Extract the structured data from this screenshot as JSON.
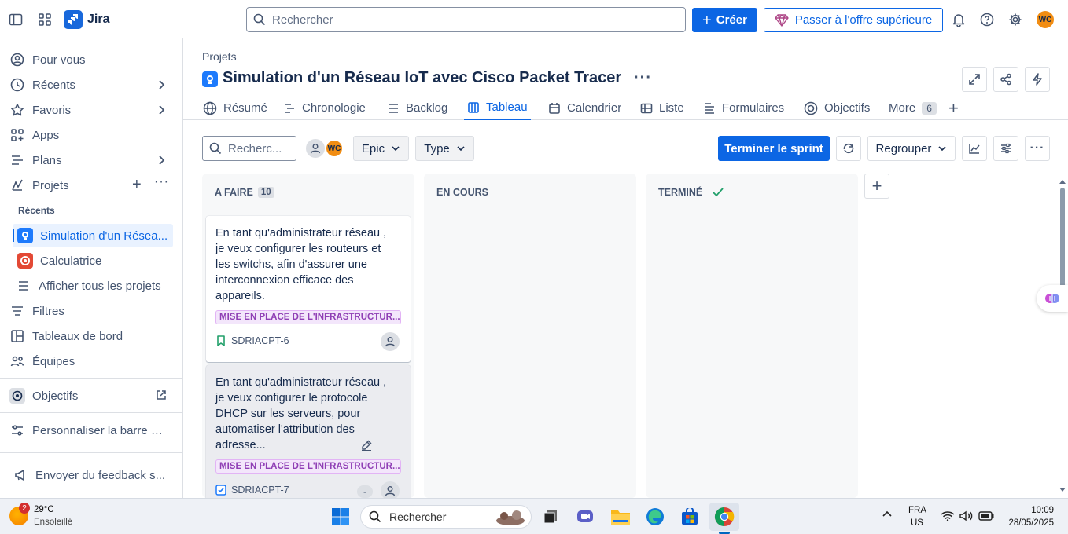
{
  "topbar": {
    "app_name": "Jira",
    "search_placeholder": "Rechercher",
    "create_label": "Créer",
    "upgrade_label": "Passer à l'offre supérieure",
    "user_initials": "WC"
  },
  "sidebar": {
    "items": [
      {
        "label": "Pour vous",
        "icon": "user-circle-icon"
      },
      {
        "label": "Récents",
        "icon": "clock-icon"
      },
      {
        "label": "Favoris",
        "icon": "star-icon"
      },
      {
        "label": "Apps",
        "icon": "apps-icon"
      },
      {
        "label": "Plans",
        "icon": "plans-icon"
      },
      {
        "label": "Projets",
        "icon": "projects-icon"
      }
    ],
    "recents_heading": "Récents",
    "projects": [
      {
        "label": "Simulation d'un Résea...",
        "selected": true
      },
      {
        "label": "Calculatrice",
        "selected": false
      }
    ],
    "show_all_projects": "Afficher tous les projets",
    "more_items": [
      {
        "label": "Filtres",
        "icon": "filter-icon"
      },
      {
        "label": "Tableaux de bord",
        "icon": "dashboard-icon"
      },
      {
        "label": "Équipes",
        "icon": "teams-icon"
      }
    ],
    "goals": "Objectifs",
    "customize": "Personnaliser la barre la...",
    "feedback": "Envoyer du feedback s..."
  },
  "header": {
    "breadcrumb": "Projets",
    "title": "Simulation d'un Réseau IoT avec Cisco Packet Tracer"
  },
  "tabs": [
    {
      "label": "Résumé",
      "icon": "globe-icon"
    },
    {
      "label": "Chronologie",
      "icon": "timeline-icon"
    },
    {
      "label": "Backlog",
      "icon": "backlog-icon"
    },
    {
      "label": "Tableau",
      "icon": "board-icon",
      "active": true
    },
    {
      "label": "Calendrier",
      "icon": "calendar-icon"
    },
    {
      "label": "Liste",
      "icon": "list-icon"
    },
    {
      "label": "Formulaires",
      "icon": "forms-icon"
    },
    {
      "label": "Objectifs",
      "icon": "target-icon"
    },
    {
      "label": "More",
      "icon": ""
    }
  ],
  "more_count": "6",
  "toolbar": {
    "search_placeholder": "Recherc...",
    "epic_label": "Epic",
    "type_label": "Type",
    "complete_sprint": "Terminer le sprint",
    "group_label": "Regrouper",
    "user_initials": "WC"
  },
  "board": {
    "columns": [
      {
        "title": "A FAIRE",
        "count": "10"
      },
      {
        "title": "EN COURS",
        "count": ""
      },
      {
        "title": "TERMINÉ",
        "count": ""
      }
    ],
    "cards": [
      {
        "text": "En tant qu'administrateur réseau , je veux configurer les routeurs et les switchs, afin d'assurer une interconnexion efficace des appareils.",
        "epic": "MISE EN PLACE DE L'INFRASTRUCTUR...",
        "key": "SDRIACPT-6",
        "type_icon": "story-icon"
      },
      {
        "text": "En tant qu'administrateur réseau , je veux configurer le protocole DHCP sur les serveurs, pour automatiser l'attribution des adresse...",
        "epic": "MISE EN PLACE DE L'INFRASTRUCTUR...",
        "key": "SDRIACPT-7",
        "estimate": "-",
        "type_icon": "task-icon"
      }
    ]
  },
  "taskbar": {
    "weather_temp": "29°C",
    "weather_desc": "Ensoleillé",
    "weather_badge": "2",
    "search_label": "Rechercher",
    "lang_top": "FRA",
    "lang_bottom": "US",
    "time": "10:09",
    "date": "28/05/2025"
  },
  "colors": {
    "accent": "#0c66e4",
    "epic_purple": "#8f3fb5",
    "avatar_orange": "#f18d13"
  }
}
